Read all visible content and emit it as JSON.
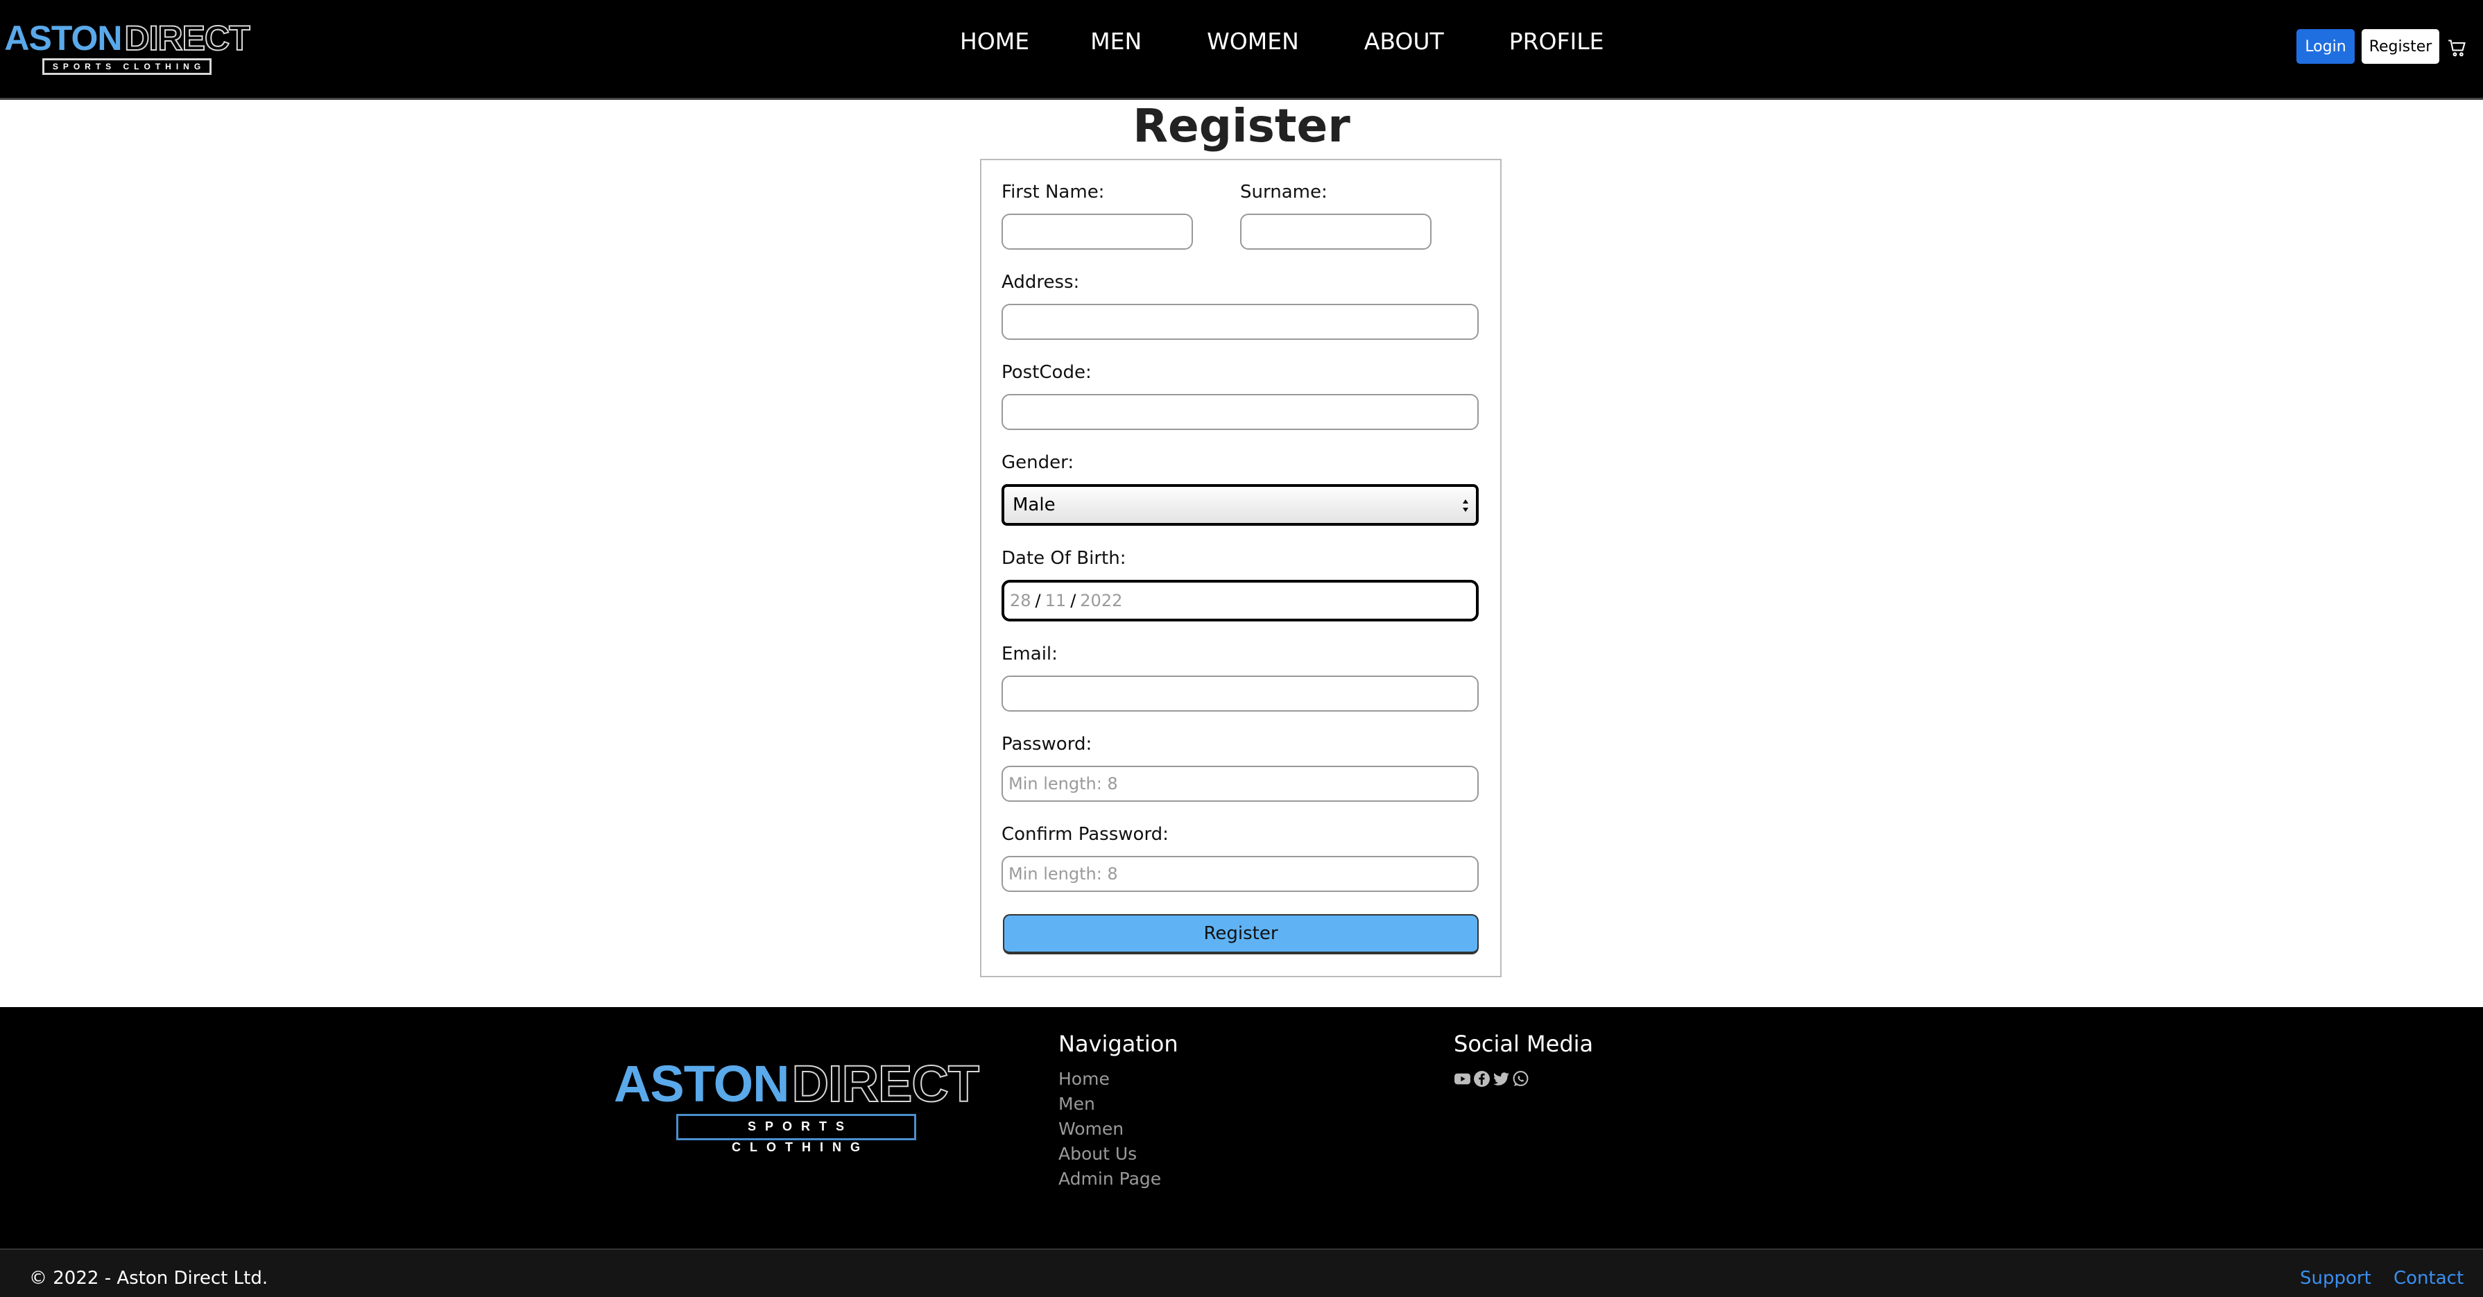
{
  "header": {
    "logo": {
      "word1": "ASTON",
      "word2": "DIRECT",
      "tagline": "SPORTS CLOTHING"
    },
    "nav": [
      "HOME",
      "MEN",
      "WOMEN",
      "ABOUT",
      "PROFILE"
    ],
    "login_label": "Login",
    "register_label": "Register",
    "cart_icon": "shopping-cart-icon",
    "login_color": "#1f6fe0"
  },
  "form": {
    "title": "Register",
    "first_name_label": "First Name:",
    "first_name_value": "",
    "surname_label": "Surname:",
    "surname_value": "",
    "address_label": "Address:",
    "address_value": "",
    "postcode_label": "PostCode:",
    "postcode_value": "",
    "gender_label": "Gender:",
    "gender_value": "Male",
    "dob_label": "Date Of Birth:",
    "dob": {
      "day": "28",
      "month": "11",
      "year": "2022",
      "separator": "/"
    },
    "email_label": "Email:",
    "email_value": "",
    "password_label": "Password:",
    "password_placeholder": "Min length: 8",
    "confirm_password_label": "Confirm Password:",
    "confirm_password_placeholder": "Min length: 8",
    "submit_label": "Register",
    "submit_color": "#5fb3f5"
  },
  "footer": {
    "logo": {
      "word1": "ASTON",
      "word2": "DIRECT",
      "tagline": "SPORTS CLOTHING"
    },
    "navigation_heading": "Navigation",
    "navigation_links": [
      "Home",
      "Men",
      "Women",
      "About Us",
      "Admin Page"
    ],
    "social_heading": "Social Media",
    "social_icons": [
      "youtube-icon",
      "facebook-icon",
      "twitter-icon",
      "whatsapp-icon"
    ],
    "copyright": "© 2022 - Aston Direct Ltd.",
    "support_label": "Support",
    "contact_label": "Contact",
    "link_color": "#3b8ff0"
  }
}
